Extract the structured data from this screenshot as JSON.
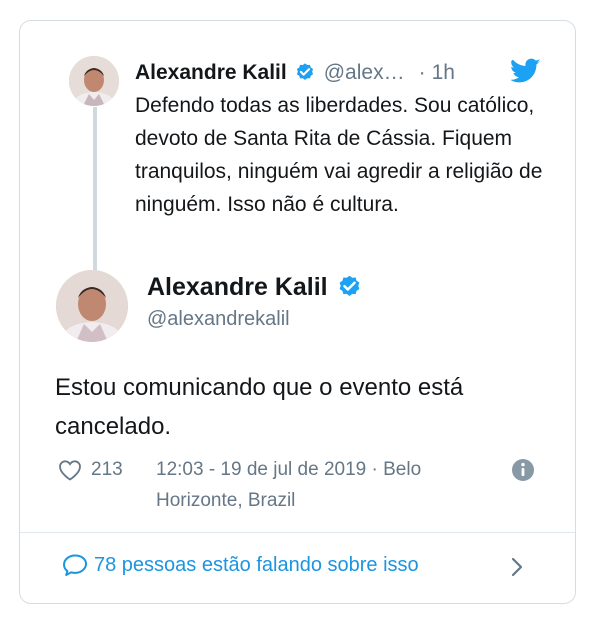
{
  "reply_tweet": {
    "author_name": "Alexandre Kalil",
    "author_handle": "@alex…",
    "time_sep": "·",
    "time": "1h",
    "text": "Defendo todas as liberdades. Sou católico, devoto de Santa Rita de Cássia. Fiquem tranquilos, ninguém vai agredir a religião de ninguém. Isso não é cultura."
  },
  "main_tweet": {
    "author_name": "Alexandre Kalil",
    "author_handle": "@alexandrekalil",
    "text": "Estou comunicando que o evento está cancelado.",
    "like_count": "213",
    "timestamp_line1": "12:03 - 19 de jul de 2019 · Belo",
    "timestamp_line2": "Horizonte, Brazil"
  },
  "footer": {
    "conversation_label": "78 pessoas estão falando sobre isso"
  },
  "icons": {
    "verified": "verified-badge-icon",
    "twitter": "twitter-bird-icon",
    "like": "heart-icon",
    "info": "info-icon",
    "reply": "speech-bubble-icon",
    "chevron": "chevron-right-icon"
  },
  "colors": {
    "accent": "#1b95e0",
    "twitter_blue": "#1da1f2",
    "muted": "#657786",
    "border": "#d6dde2"
  }
}
